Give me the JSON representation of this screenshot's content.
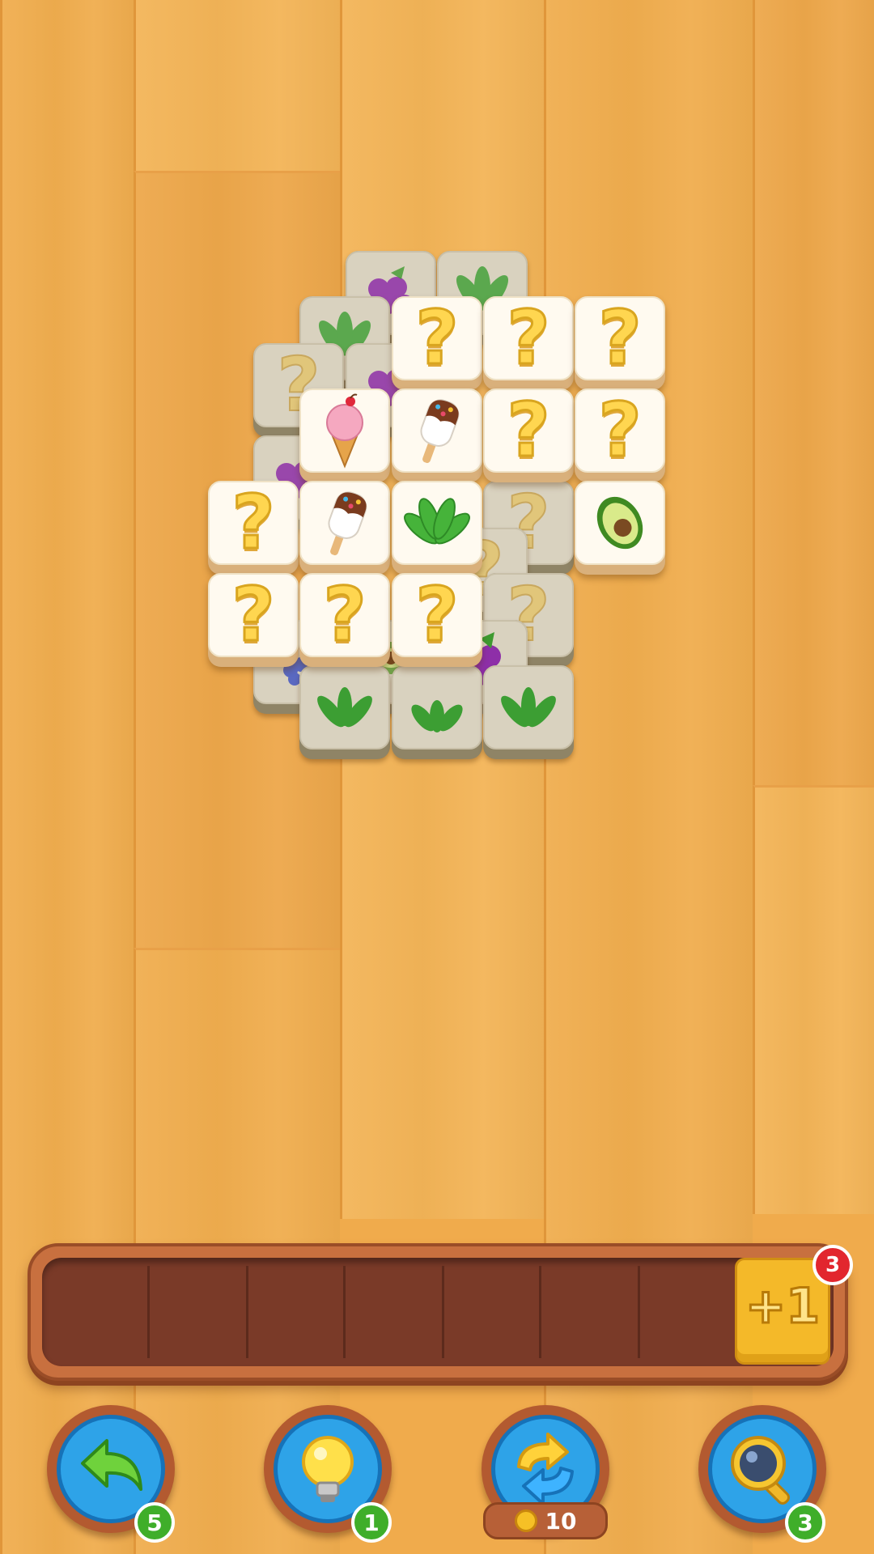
{
  "game": {
    "tray": {
      "add_slot_label": "+1",
      "add_slot_count": "3"
    },
    "boosters": [
      {
        "name": "undo",
        "icon": "undo-arrow-icon",
        "count": "5"
      },
      {
        "name": "hint",
        "icon": "lightbulb-icon",
        "count": "1"
      },
      {
        "name": "shuffle",
        "icon": "shuffle-arrows-icon",
        "count": "",
        "cost": "10"
      },
      {
        "name": "magnifier",
        "icon": "magnifier-icon",
        "count": "3"
      }
    ],
    "hidden_tile_label": "?",
    "colors": {
      "tray": "#7a3a28",
      "plus_button": "#f4b929",
      "badge_red": "#e2262e",
      "badge_green": "#3fae2a",
      "booster_ring": "#2ea3e8"
    }
  }
}
